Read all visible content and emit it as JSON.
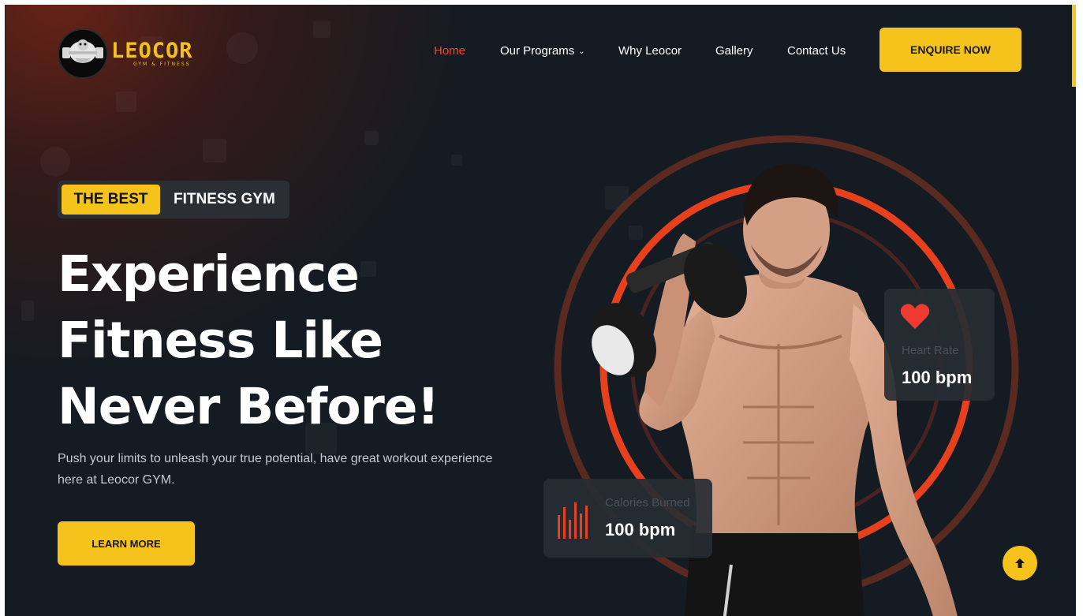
{
  "brand": {
    "name": "LEOCOR",
    "tagline": "GYM & FITNESS",
    "accent_color": "#f6c21c",
    "highlight_color": "#ef4b23",
    "background_color": "#141b22"
  },
  "nav": {
    "items": [
      {
        "label": "Home",
        "active": true
      },
      {
        "label": "Our Programs",
        "active": false,
        "has_dropdown": true
      },
      {
        "label": "Why Leocor",
        "active": false
      },
      {
        "label": "Gallery",
        "active": false
      },
      {
        "label": "Contact Us",
        "active": false
      }
    ],
    "cta_label": "ENQUIRE NOW",
    "dropdown_icon": "chevron-down-icon"
  },
  "hero": {
    "badge_highlight": "THE BEST",
    "badge_text": "FITNESS GYM",
    "headline_lines": [
      "Experience",
      "Fitness Like",
      "Never Before!"
    ],
    "description": "Push your limits to unleash your true potential, have great workout experience here at Leocor GYM.",
    "cta_label": "LEARN MORE"
  },
  "stats": {
    "heart_rate": {
      "label": "Heart Rate",
      "value": "100 bpm",
      "icon": "heart-icon"
    },
    "calories": {
      "label": "Calories Burned",
      "value": "100 bpm",
      "icon": "bar-chart-icon"
    }
  },
  "scroll_top": {
    "icon": "arrow-up-icon"
  }
}
